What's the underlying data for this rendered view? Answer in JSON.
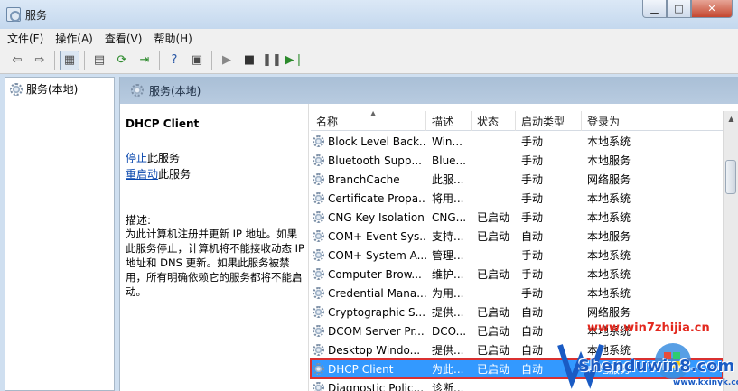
{
  "window": {
    "title": "服务"
  },
  "menu": [
    "文件(F)",
    "操作(A)",
    "查看(V)",
    "帮助(H)"
  ],
  "tree": {
    "root_label": "服务(本地)"
  },
  "pane": {
    "header": "服务(本地)"
  },
  "details": {
    "service_name": "DHCP Client",
    "stop_link": "停止",
    "stop_suffix": "此服务",
    "restart_link": "重启动",
    "restart_suffix": "此服务",
    "desc_label": "描述:",
    "desc_text": "为此计算机注册并更新 IP 地址。如果此服务停止，计算机将不能接收动态 IP 地址和 DNS 更新。如果此服务被禁用，所有明确依赖它的服务都将不能启动。"
  },
  "columns": [
    "名称",
    "描述",
    "状态",
    "启动类型",
    "登录为"
  ],
  "services": [
    {
      "name": "Block Level Back...",
      "desc": "Win...",
      "status": "",
      "startup": "手动",
      "logon": "本地系统"
    },
    {
      "name": "Bluetooth Supp...",
      "desc": "Blue...",
      "status": "",
      "startup": "手动",
      "logon": "本地服务"
    },
    {
      "name": "BranchCache",
      "desc": "此服...",
      "status": "",
      "startup": "手动",
      "logon": "网络服务"
    },
    {
      "name": "Certificate Propa...",
      "desc": "将用...",
      "status": "",
      "startup": "手动",
      "logon": "本地系统"
    },
    {
      "name": "CNG Key Isolation",
      "desc": "CNG...",
      "status": "已启动",
      "startup": "手动",
      "logon": "本地系统"
    },
    {
      "name": "COM+ Event Sys...",
      "desc": "支持...",
      "status": "已启动",
      "startup": "自动",
      "logon": "本地服务"
    },
    {
      "name": "COM+ System A...",
      "desc": "管理...",
      "status": "",
      "startup": "手动",
      "logon": "本地系统"
    },
    {
      "name": "Computer Brow...",
      "desc": "维护...",
      "status": "已启动",
      "startup": "手动",
      "logon": "本地系统"
    },
    {
      "name": "Credential Mana...",
      "desc": "为用...",
      "status": "",
      "startup": "手动",
      "logon": "本地系统"
    },
    {
      "name": "Cryptographic S...",
      "desc": "提供...",
      "status": "已启动",
      "startup": "自动",
      "logon": "网络服务"
    },
    {
      "name": "DCOM Server Pr...",
      "desc": "DCO...",
      "status": "已启动",
      "startup": "自动",
      "logon": "本地系统"
    },
    {
      "name": "Desktop Windo...",
      "desc": "提供...",
      "status": "已启动",
      "startup": "自动",
      "logon": "本地系统"
    },
    {
      "name": "DHCP Client",
      "desc": "为此...",
      "status": "已启动",
      "startup": "自动",
      "logon": "本地服务",
      "selected": true
    },
    {
      "name": "Diagnostic Polic...",
      "desc": "诊断...",
      "status": "",
      "startup": "",
      "logon": ""
    }
  ],
  "watermark": {
    "url": "www.win7zhijia.cn",
    "brand": "Shenduwin8.com",
    "site": "www.kxinyk.com"
  }
}
